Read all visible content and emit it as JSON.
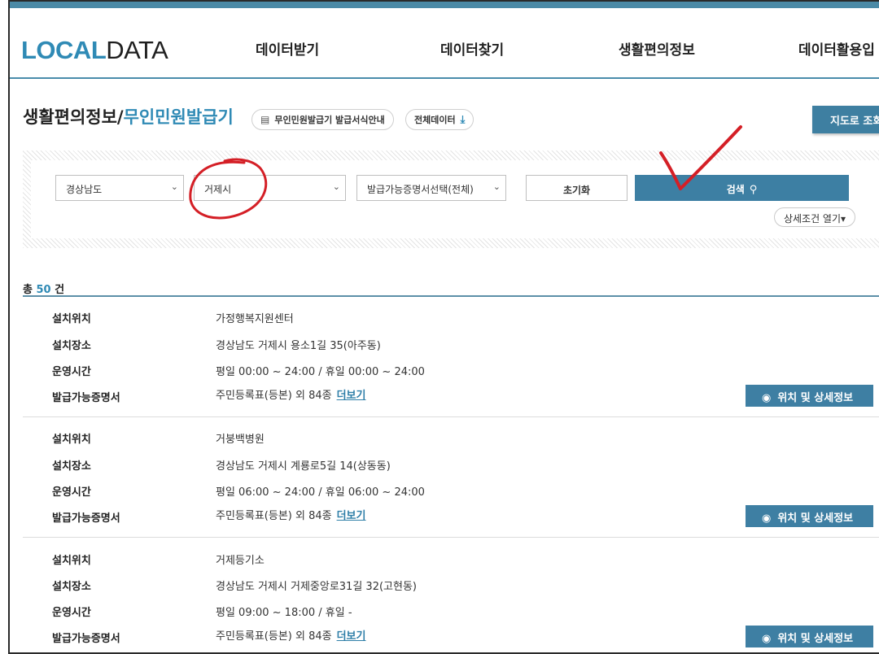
{
  "logo": {
    "part1": "LOCAL",
    "part2": "DATA"
  },
  "nav": [
    "데이터받기",
    "데이터찾기",
    "생활편의정보",
    "데이터활용입"
  ],
  "page": {
    "title_main": "생활편의정보/",
    "title_sub": "무인민원발급기",
    "guide_pill": "무인민원발급기 발급서식안내",
    "download_pill": "전체데이터",
    "map_button": "지도로 조회"
  },
  "search": {
    "province": "경상남도",
    "city": "거제시",
    "certificate": "발급가능증명서선택(전체)",
    "reset_label": "초기화",
    "search_label": "검색",
    "detail_toggle": "상세조건 열기▾"
  },
  "results": {
    "total_prefix": "총",
    "total_count": "50",
    "total_suffix": "건",
    "labels": {
      "location": "설치위치",
      "place": "설치장소",
      "hours": "운영시간",
      "certs": "발급가능증명서"
    },
    "more_label": "더보기",
    "detail_button": "위치 및 상세정보",
    "records": [
      {
        "location": "가정행복지원센터",
        "place": "경상남도 거제시 용소1길 35(아주동)",
        "hours": "평일 00:00 ~ 24:00 / 휴일 00:00 ~ 24:00",
        "certs": "주민등록표(등본) 외 84종"
      },
      {
        "location": "거붕백병원",
        "place": "경상남도 거제시 계룡로5길 14(상동동)",
        "hours": "평일 06:00 ~ 24:00 / 휴일 06:00 ~ 24:00",
        "certs": "주민등록표(등본) 외 84종"
      },
      {
        "location": "거제등기소",
        "place": "경상남도 거제시 거제중앙로31길 32(고현동)",
        "hours": "평일 09:00 ~ 18:00 / 휴일 -",
        "certs": "주민등록표(등본) 외 84종"
      }
    ]
  },
  "colors": {
    "accent": "#2f8ab5",
    "button": "#3e7fa3",
    "annotation": "#d41f26"
  }
}
